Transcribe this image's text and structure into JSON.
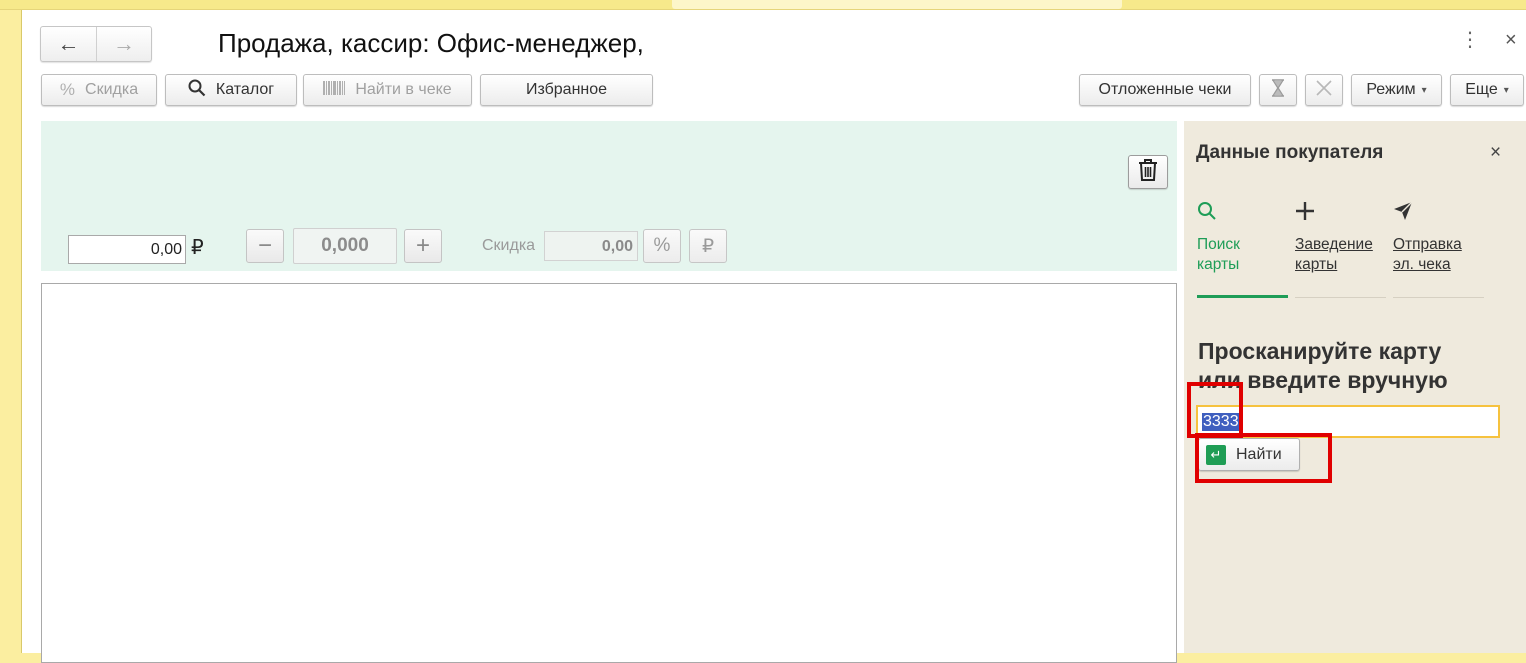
{
  "window": {
    "title": "Продажа, кассир: Офис-менеджер,",
    "back_icon": "←",
    "forward_icon": "→",
    "menu_icon": "⋮",
    "close_icon": "×"
  },
  "toolbar": {
    "discount_label": "Скидка",
    "catalog_label": "Каталог",
    "find_in_receipt_label": "Найти в чеке",
    "favorites_label": "Избранное",
    "deferred_label": "Отложенные чеки",
    "mode_label": "Режим",
    "more_label": "Еще"
  },
  "item_panel": {
    "price_value": "0,00",
    "currency": "₽",
    "quantity_value": "0,000",
    "minus": "−",
    "plus": "+",
    "discount_label": "Скидка",
    "discount_value": "0,00",
    "percent_symbol": "%",
    "ruble_symbol": "₽"
  },
  "buyer_panel": {
    "title": "Данные покупателя",
    "close": "×",
    "tabs": [
      {
        "label_line1": "Поиск",
        "label_line2": "карты",
        "icon": "search-icon",
        "active": true
      },
      {
        "label_line1": "Заведение",
        "label_line2": "карты",
        "icon": "plus-icon",
        "active": false
      },
      {
        "label_line1": "Отправка",
        "label_line2": "эл. чека",
        "icon": "send-icon",
        "active": false
      }
    ],
    "prompt_line1": "Просканируйте карту",
    "prompt_line2": "или введите вручную",
    "card_value": "3333",
    "find_label": "Найти",
    "accent_color": "#1e9d57",
    "highlight_color": "#e00000"
  }
}
